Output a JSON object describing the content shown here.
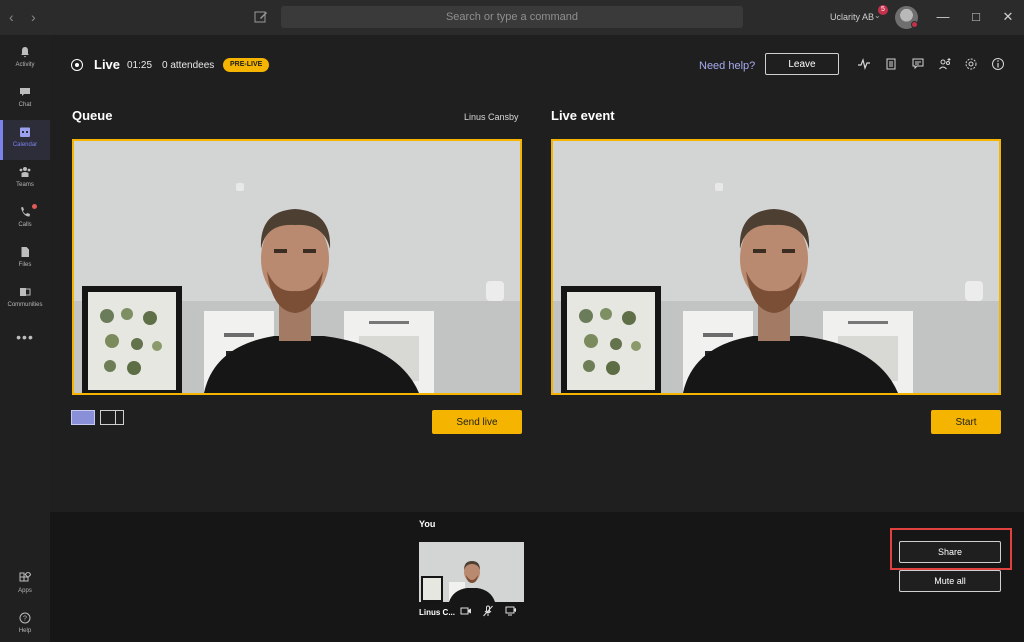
{
  "titlebar": {
    "search_placeholder": "Search or type a command",
    "org_name": "Uclarity AB",
    "org_badge": "5"
  },
  "sidebar": {
    "items": [
      {
        "label": "Activity",
        "icon": "bell-icon"
      },
      {
        "label": "Chat",
        "icon": "chat-icon"
      },
      {
        "label": "Calendar",
        "icon": "calendar-icon",
        "active": true
      },
      {
        "label": "Teams",
        "icon": "teams-icon"
      },
      {
        "label": "Calls",
        "icon": "phone-icon",
        "dot": true
      },
      {
        "label": "Files",
        "icon": "file-icon"
      },
      {
        "label": "Communities",
        "icon": "communities-icon"
      },
      {
        "label": "Apps",
        "icon": "apps-icon"
      },
      {
        "label": "Help",
        "icon": "help-icon"
      }
    ]
  },
  "header": {
    "title": "Live",
    "timer": "01:25",
    "attendees": "0 attendees",
    "status_badge": "PRE-LIVE",
    "need_help": "Need help?",
    "leave_label": "Leave"
  },
  "queue": {
    "title": "Queue",
    "presenter": "Linus Cansby",
    "action_label": "Send live"
  },
  "live_event": {
    "title": "Live event",
    "action_label": "Start"
  },
  "bottom": {
    "you_label": "You",
    "participant_name": "Linus C...",
    "share_label": "Share",
    "mute_all_label": "Mute all"
  },
  "colors": {
    "accent": "#f4b400",
    "brand": "#7b83eb",
    "highlight": "#e0433f"
  }
}
